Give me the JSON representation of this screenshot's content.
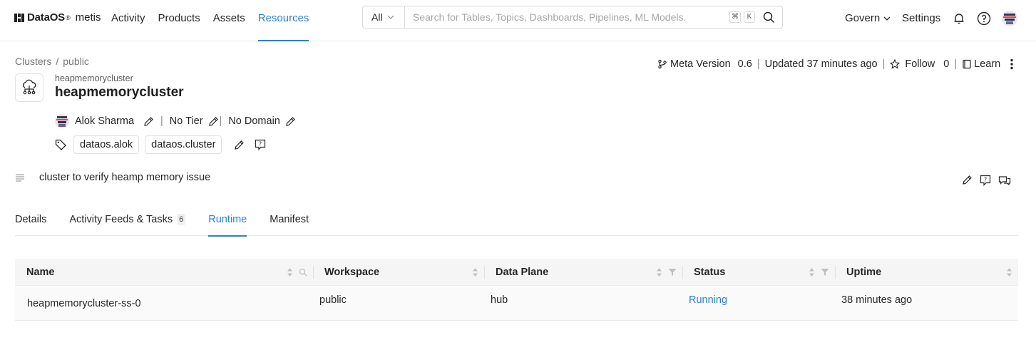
{
  "brand": {
    "name": "DataOS",
    "mark": "®",
    "product": "metis"
  },
  "nav": {
    "items": [
      "Activity",
      "Products",
      "Assets",
      "Resources"
    ],
    "active": "Resources"
  },
  "search": {
    "scope": "All",
    "placeholder": "Search for Tables, Topics, Dashboards, Pipelines, ML Models.",
    "shortcut_keys": [
      "⌘",
      "K"
    ]
  },
  "top_right": {
    "govern": "Govern",
    "settings": "Settings"
  },
  "breadcrumb": [
    "Clusters",
    "/",
    "public"
  ],
  "entity": {
    "subtitle": "heapmemorycluster",
    "title": "heapmemorycluster",
    "icon": "cluster-icon"
  },
  "meta": {
    "version_label": "Meta Version",
    "version": "0.6",
    "updated": "Updated 37 minutes ago",
    "follow_label": "Follow",
    "follow_count": "0",
    "learn_label": "Learn"
  },
  "owner": {
    "name": "Alok Sharma",
    "tier": "No Tier",
    "domain": "No Domain"
  },
  "tags": [
    "dataos.alok",
    "dataos.cluster"
  ],
  "description": "cluster to verify heamp memory issue",
  "tabs": [
    {
      "label": "Details",
      "count": ""
    },
    {
      "label": "Activity Feeds & Tasks",
      "count": "6"
    },
    {
      "label": "Runtime",
      "count": ""
    },
    {
      "label": "Manifest",
      "count": ""
    }
  ],
  "active_tab": "Runtime",
  "table": {
    "columns": [
      "Name",
      "Workspace",
      "Data Plane",
      "Status",
      "Uptime"
    ],
    "rows": [
      [
        "heapmemorycluster-ss-0",
        "public",
        "hub",
        "Running",
        "38 minutes ago"
      ]
    ]
  },
  "colors": {
    "accent": "#2b7de0",
    "header_bg": "#f5f5f5"
  }
}
